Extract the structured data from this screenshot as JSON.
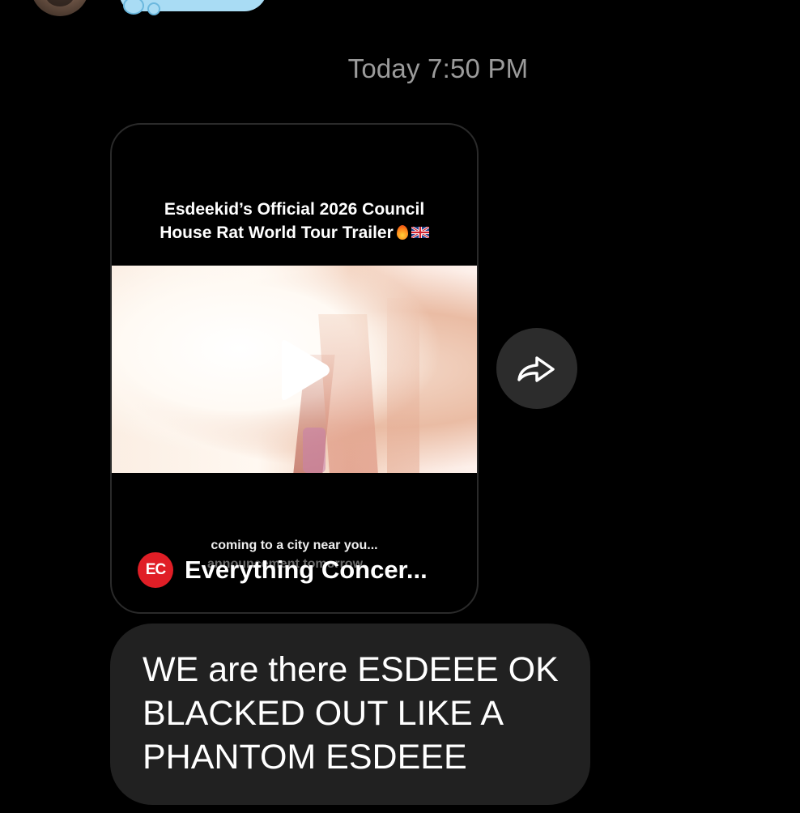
{
  "timestamp": "Today 7:50 PM",
  "shared_reel": {
    "caption_line1": "Esdeekid’s Official 2026 Council",
    "caption_line2": "House Rat World Tour Trailer",
    "subtitle_line1": "coming to a city near you...",
    "subtitle_line2": "announcement tomorrow",
    "source_logo_text": "EC",
    "source_name": "Everything Concer...",
    "colors": {
      "logo_bg": "#e01e26"
    }
  },
  "message": {
    "text": "WE are there ESDEEE OK\nBLACKED OUT LIKE A\nPHANTOM ESDEEE",
    "bubble_color": "#212121"
  },
  "icons": {
    "share": "share-arrow-icon",
    "play": "play-icon",
    "flame": "fire-emoji",
    "flag": "uk-flag-emoji"
  },
  "colors": {
    "background": "#000000",
    "timestamp": "#9b9b9b",
    "prev_bubble": "#a9dcf4"
  }
}
